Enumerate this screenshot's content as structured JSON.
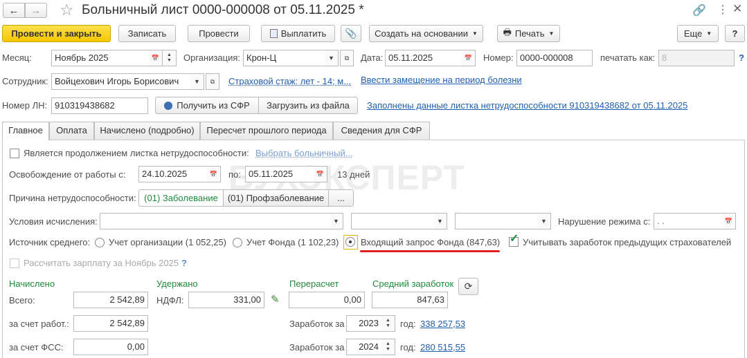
{
  "window": {
    "title": "Больничный лист 0000-000008 от 05.11.2025 *",
    "back_icon": "arrow-left-icon",
    "forward_icon": "arrow-right-icon",
    "star_icon": "star-icon"
  },
  "toolbar": {
    "post_close": "Провести и закрыть",
    "write": "Записать",
    "post": "Провести",
    "pay": "Выплатить",
    "create_based": "Создать на основании",
    "print": "Печать",
    "more": "Еще",
    "help": "?"
  },
  "header": {
    "month_label": "Месяц:",
    "month_value": "Ноябрь 2025",
    "org_label": "Организация:",
    "org_value": "Крон-Ц",
    "date_label": "Дата:",
    "date_value": "05.11.2025",
    "number_label": "Номер:",
    "number_value": "0000-000008",
    "print_as_label": "печатать как:",
    "print_as_placeholder": "8",
    "help_q": "?",
    "employee_label": "Сотрудник:",
    "employee_value": "Войцехович Игорь Борисович",
    "insurance_link": "Страховой стаж: лет - 14; м...",
    "replacement_link": "Ввести замещение на период болезни",
    "ln_label": "Номер ЛН:",
    "ln_value": "910319438682",
    "get_sfr": "Получить из СФР",
    "load_file": "Загрузить из файла",
    "filled_link": "Заполнены данные листка нетрудоспособности 910319438682 от 05.11.2025"
  },
  "tabs": [
    "Главное",
    "Оплата",
    "Начислено (подробно)",
    "Пересчет прошлого периода",
    "Сведения для СФР"
  ],
  "main": {
    "continuation_label": "Является продолжением листка нетрудоспособности:",
    "select_sick_link": "Выбрать больничный...",
    "release_label": "Освобождение от работы с:",
    "release_from": "24.10.2025",
    "release_to_label": "по:",
    "release_to": "05.11.2025",
    "days": "13 дней",
    "reason_label": "Причина нетрудоспособности:",
    "reason_opt1": "(01) Заболевание",
    "reason_opt2": "(01) Профзаболевание",
    "reason_more": "...",
    "conditions_label": "Условия исчисления:",
    "violation_label": "Нарушение режима с:",
    "violation_value": " .  .",
    "source_label": "Источник среднего:",
    "source_org": "Учет организации (1 052,25)",
    "source_fund": "Учет Фонда (1 102,23)",
    "source_request": "Входящий запрос Фонда (847,63)",
    "prev_insurers": "Учитывать заработок предыдущих страхователей",
    "calc_salary": "Рассчитать зарплату за Ноябрь 2025",
    "calc_help": "?"
  },
  "totals": {
    "accrued_title": "Начислено",
    "withheld_title": "Удержано",
    "recalc_title": "Перерасчет",
    "avg_title": "Средний заработок",
    "total_label": "Всего:",
    "total_value": "2 542,89",
    "ndfl_label": "НДФЛ:",
    "ndfl_value": "331,00",
    "recalc_value": "0,00",
    "avg_value": "847,63",
    "employer_label": "за счет работ.:",
    "employer_value": "2 542,89",
    "fss_label": "за счет ФСС:",
    "fss_value": "0,00",
    "earn_label_1": "Заработок за",
    "earn_year_1": "2023",
    "year_label_1": "год:",
    "earn_amount_1": "338 257,53",
    "earn_label_2": "Заработок за",
    "earn_year_2": "2024",
    "year_label_2": "год:",
    "earn_amount_2": "280 515,55"
  },
  "watermark": "БУХЭКСПЕРТ",
  "colors": {
    "primary_button": "#f5c700",
    "link": "#1f5faf",
    "section_title": "#1e8a3c",
    "highlight_underline": "#e02020"
  }
}
